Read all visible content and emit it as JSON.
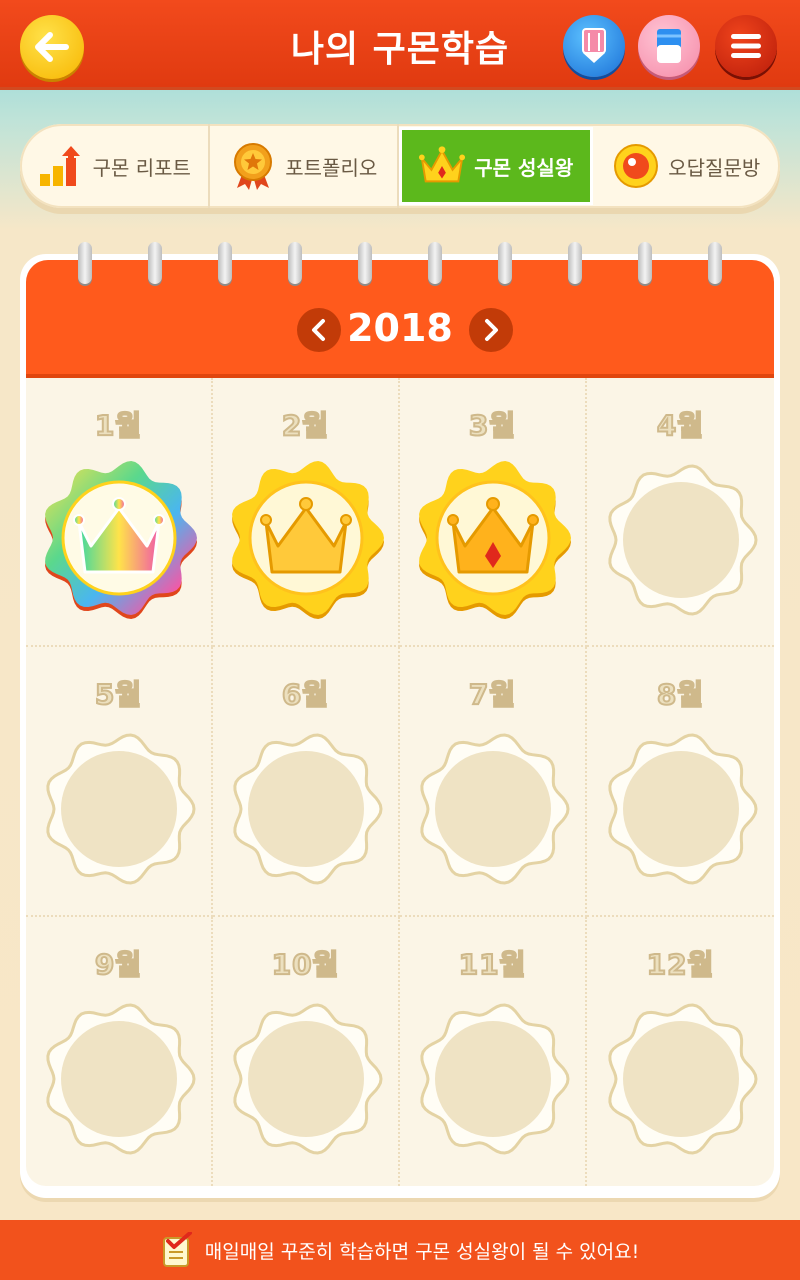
{
  "header": {
    "title": "나의 구몬학습",
    "back_icon": "arrow-left-icon",
    "buttons": [
      {
        "name": "pencil",
        "icon": "pencil-icon"
      },
      {
        "name": "eraser",
        "icon": "eraser-icon"
      },
      {
        "name": "menu",
        "icon": "hamburger-menu-icon"
      }
    ]
  },
  "tabs": [
    {
      "label": "구몬 리포트",
      "icon": "bar-chart-icon",
      "active": false
    },
    {
      "label": "포트폴리오",
      "icon": "medal-icon",
      "active": false
    },
    {
      "label": "구몬 성실왕",
      "icon": "crown-icon",
      "active": true
    },
    {
      "label": "오답질문방",
      "icon": "record-icon",
      "active": false
    }
  ],
  "calendar": {
    "year": "2018",
    "months": [
      {
        "label": "1월",
        "badge": "rainbow"
      },
      {
        "label": "2월",
        "badge": "gold"
      },
      {
        "label": "3월",
        "badge": "gold-jewel"
      },
      {
        "label": "4월",
        "badge": "empty"
      },
      {
        "label": "5월",
        "badge": "empty"
      },
      {
        "label": "6월",
        "badge": "empty"
      },
      {
        "label": "7월",
        "badge": "empty"
      },
      {
        "label": "8월",
        "badge": "empty"
      },
      {
        "label": "9월",
        "badge": "empty"
      },
      {
        "label": "10월",
        "badge": "empty"
      },
      {
        "label": "11월",
        "badge": "empty"
      },
      {
        "label": "12월",
        "badge": "empty"
      }
    ]
  },
  "footer": {
    "message": "매일매일 꾸준히 학습하면 구몬 성실왕이 될 수 있어요!",
    "icon": "checklist-icon"
  },
  "colors": {
    "header": "#e8441a",
    "tab_active": "#5cb81c",
    "calendar_head": "#ff5a1c",
    "footer": "#f2521c"
  }
}
